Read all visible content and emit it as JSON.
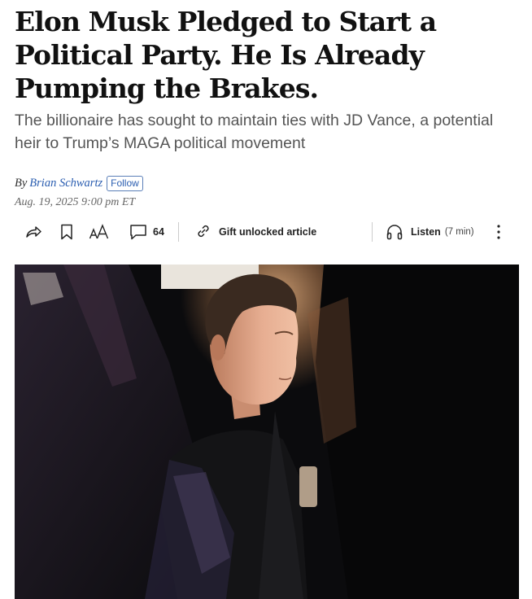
{
  "article": {
    "headline": "Elon Musk Pledged to Start a Political Party. He Is Already Pumping the Brakes.",
    "dek": "The billionaire has sought to maintain ties with JD Vance, a potential heir to Trump’s MAGA political movement",
    "byline": {
      "prefix": "By",
      "author": "Brian Schwartz",
      "follow_label": "Follow"
    },
    "date": "Aug. 19, 2025 9:00 pm ET"
  },
  "toolbar": {
    "share_icon": "share-icon",
    "bookmark_icon": "bookmark-icon",
    "text_size_icon": "text-size-icon",
    "comments_icon": "comment-icon",
    "comments_count": "64",
    "gift_icon": "link-icon",
    "gift_label": "Gift unlocked article",
    "listen_icon": "headphones-icon",
    "listen_label": "Listen",
    "listen_duration": "(7 min)",
    "more_icon": "more-vertical-icon"
  },
  "image": {
    "description_icon": "photo",
    "palette": {
      "background": "#0b0b0d",
      "skin": "#e3a88c",
      "hair": "#3a2a20"
    }
  }
}
